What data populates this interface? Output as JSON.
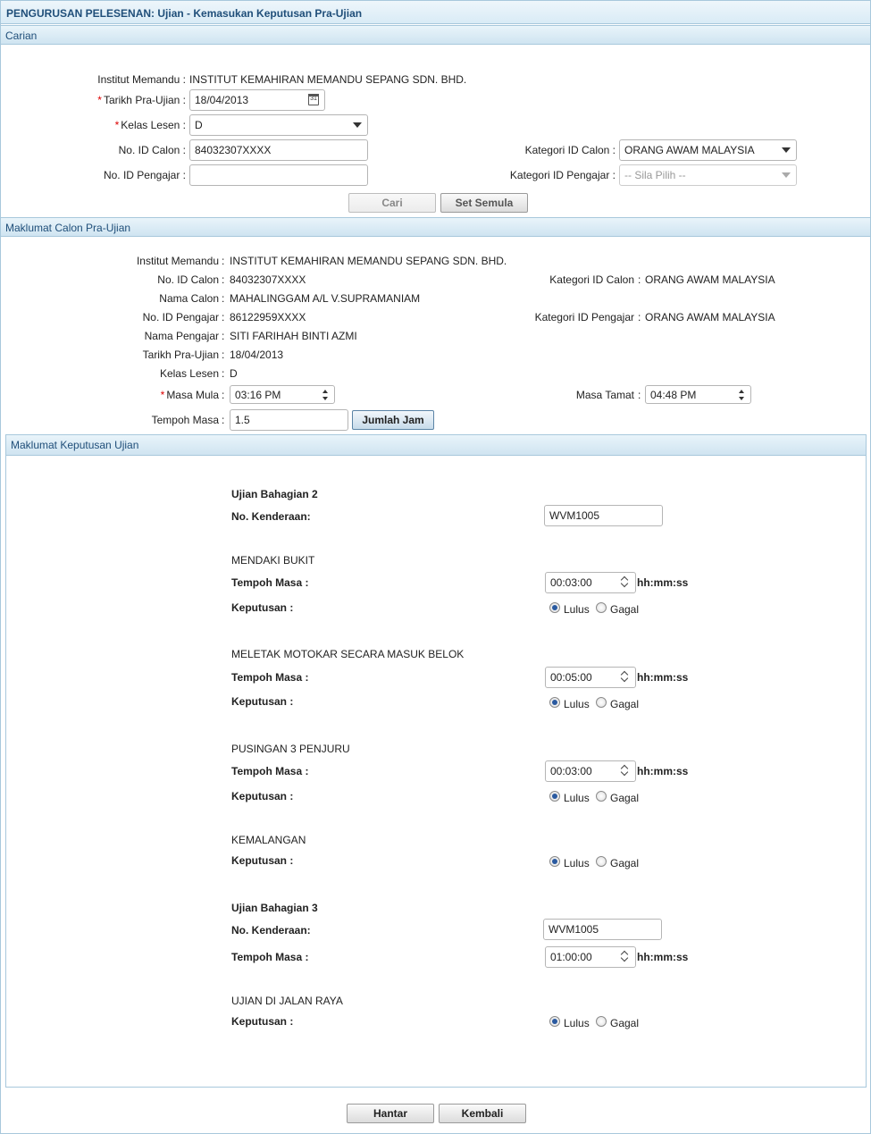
{
  "page_title": "PENGURUSAN PELESENAN: Ujian - Kemasukan Keputusan Pra-Ujian",
  "search": {
    "section_title": "Carian",
    "institut_label": "Institut Memandu :",
    "institut_value": "INSTITUT KEMAHIRAN MEMANDU SEPANG SDN. BHD.",
    "tarikh_label": "Tarikh Pra-Ujian :",
    "tarikh_value": "18/04/2013",
    "calendar_icon_text": "31",
    "kelas_label": "Kelas Lesen :",
    "kelas_value": "D",
    "id_calon_label": "No. ID Calon :",
    "id_calon_value": "84032307XXXX",
    "id_pengajar_label": "No. ID Pengajar :",
    "id_pengajar_value": "",
    "kategori_calon_label": "Kategori ID Calon :",
    "kategori_calon_value": "ORANG AWAM MALAYSIA",
    "kategori_pengajar_label": "Kategori ID Pengajar :",
    "kategori_pengajar_value": "-- Sila Pilih --",
    "cari_button": "Cari",
    "reset_button": "Set Semula",
    "required_mark": "*"
  },
  "calon": {
    "section_title": "Maklumat Calon Pra-Ujian",
    "institut_label": "Institut Memandu",
    "institut_value": "INSTITUT KEMAHIRAN MEMANDU SEPANG SDN. BHD.",
    "id_calon_label": "No. ID Calon",
    "id_calon_value": "84032307XXXX",
    "nama_calon_label": "Nama Calon",
    "nama_calon_value": "MAHALINGGAM A/L V.SUPRAMANIAM",
    "id_pengajar_label": "No. ID Pengajar",
    "id_pengajar_value": "86122959XXXX",
    "nama_pengajar_label": "Nama Pengajar",
    "nama_pengajar_value": "SITI FARIHAH BINTI AZMI",
    "tarikh_label": "Tarikh Pra-Ujian",
    "tarikh_value": "18/04/2013",
    "kelas_label": "Kelas Lesen",
    "kelas_value": "D",
    "masa_mula_label": "Masa Mula",
    "masa_mula_value": "03:16 PM",
    "tempoh_label": "Tempoh Masa",
    "tempoh_value": "1.5",
    "jumlah_button": "Jumlah Jam",
    "kategori_calon_label": "Kategori ID Calon",
    "kategori_calon_value": "ORANG AWAM MALAYSIA",
    "kategori_pengajar_label": "Kategori ID Pengajar",
    "kategori_pengajar_value": "ORANG AWAM MALAYSIA",
    "masa_tamat_label": "Masa Tamat",
    "masa_tamat_value": "04:48 PM",
    "colon": ":"
  },
  "keputusan": {
    "section_title": "Maklumat Keputusan Ujian",
    "bahagian2_title": "Ujian Bahagian 2",
    "kenderaan_label": "No. Kenderaan:",
    "kenderaan2_value": "WVM1005",
    "tempoh_label": "Tempoh Masa :",
    "keputusan_label": "Keputusan :",
    "unit": "hh:mm:ss",
    "lulus": "Lulus",
    "gagal": "Gagal",
    "mendaki_title": "MENDAKI BUKIT",
    "mendaki_tempoh": "00:03:00",
    "meletak_title": "MELETAK MOTOKAR SECARA MASUK BELOK",
    "meletak_tempoh": "00:05:00",
    "pusingan_title": "PUSINGAN 3 PENJURU",
    "pusingan_tempoh": "00:03:00",
    "kemalangan_title": "KEMALANGAN",
    "bahagian3_title": "Ujian Bahagian 3",
    "kenderaan3_value": "WVM1005",
    "bahagian3_tempoh": "01:00:00",
    "jalanraya_title": "UJIAN DI JALAN RAYA"
  },
  "footer": {
    "hantar_button": "Hantar",
    "kembali_button": "Kembali"
  }
}
